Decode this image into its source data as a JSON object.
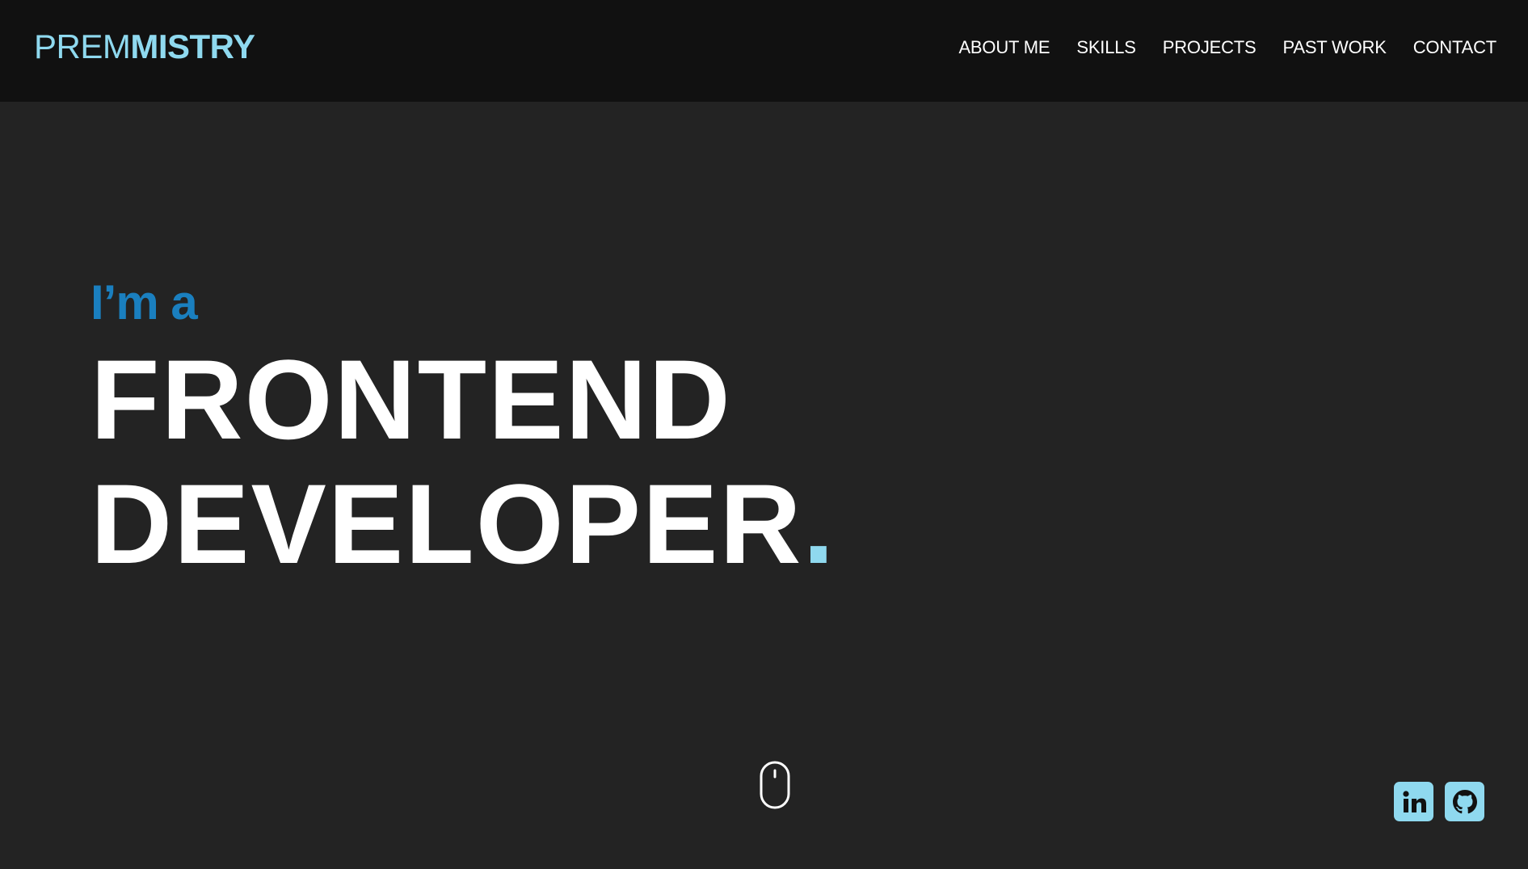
{
  "colors": {
    "accent_light": "#8fd9ef",
    "accent_blue": "#1a7fbf",
    "text": "#ffffff",
    "nav_bg": "#111111",
    "page_bg": "#232323"
  },
  "header": {
    "logo_light": "PREM",
    "logo_bold": "MISTRY",
    "nav": [
      {
        "label": "ABOUT ME"
      },
      {
        "label": "SKILLS"
      },
      {
        "label": "PROJECTS"
      },
      {
        "label": "PAST WORK"
      },
      {
        "label": "CONTACT"
      }
    ]
  },
  "hero": {
    "intro": "I’m a",
    "line1": "FRONTEND",
    "line2": "DEVELOPER",
    "period": "."
  },
  "scroll_indicator": {
    "icon": "mouse-scroll-icon"
  },
  "socials": [
    {
      "icon": "linkedin-icon"
    },
    {
      "icon": "github-icon"
    }
  ]
}
